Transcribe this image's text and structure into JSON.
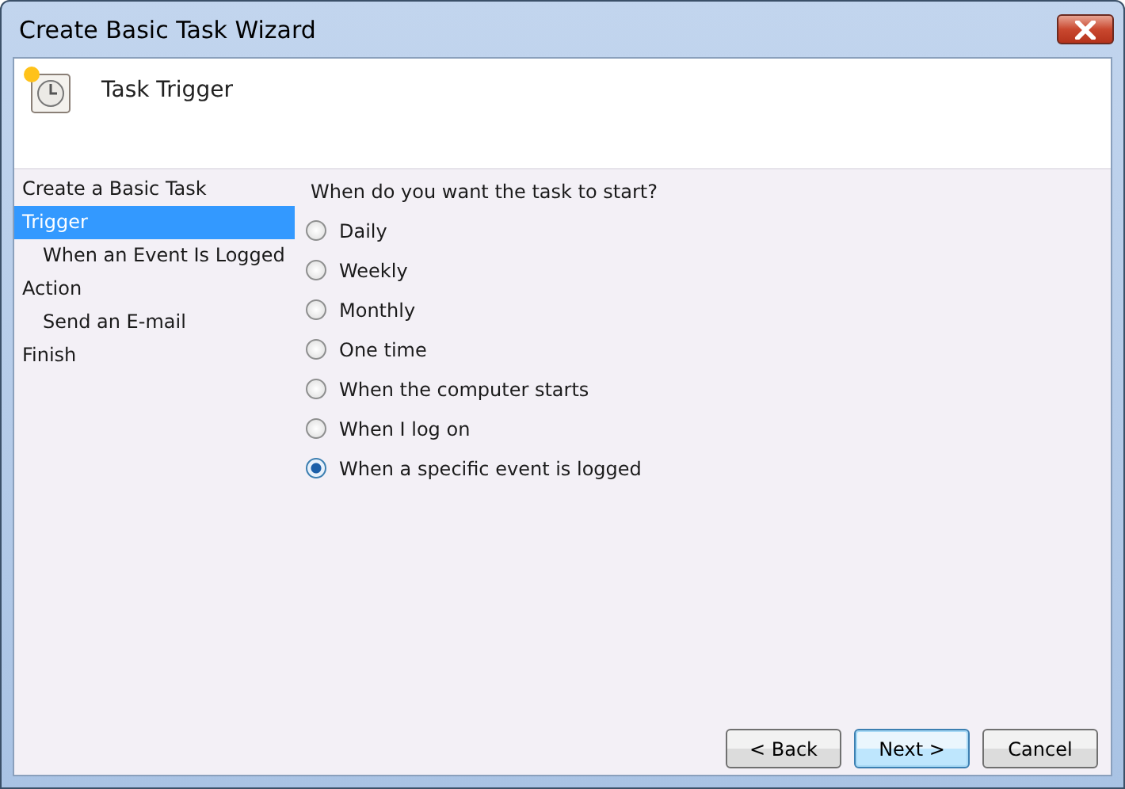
{
  "window": {
    "title": "Create Basic Task Wizard"
  },
  "header": {
    "title": "Task Trigger"
  },
  "sidebar": {
    "items": [
      {
        "label": "Create a Basic Task",
        "selected": false
      },
      {
        "label": "Trigger",
        "selected": true,
        "children": [
          {
            "label": "When an Event Is Logged",
            "selected": false
          }
        ]
      },
      {
        "label": "Action",
        "selected": false,
        "children": [
          {
            "label": "Send an E-mail",
            "selected": false
          }
        ]
      },
      {
        "label": "Finish",
        "selected": false
      }
    ]
  },
  "question": "When do you want the task to start?",
  "options": [
    {
      "label": "Daily",
      "selected": false
    },
    {
      "label": "Weekly",
      "selected": false
    },
    {
      "label": "Monthly",
      "selected": false
    },
    {
      "label": "One time",
      "selected": false
    },
    {
      "label": "When the computer starts",
      "selected": false
    },
    {
      "label": "When I log on",
      "selected": false
    },
    {
      "label": "When a specific event is logged",
      "selected": true
    }
  ],
  "buttons": [
    {
      "label": "< Back",
      "default": false
    },
    {
      "label": "Next >",
      "default": true
    },
    {
      "label": "Cancel",
      "default": false
    }
  ]
}
